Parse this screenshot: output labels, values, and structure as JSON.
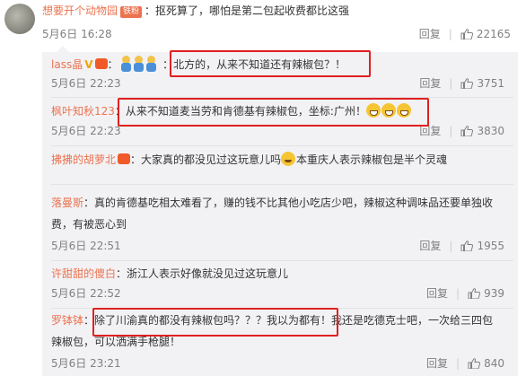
{
  "main_comment": {
    "username": "想要开个动物园",
    "badge": "铁粉",
    "text": "：抠死算了，哪怕是第二包起收费都比这强",
    "time": "5月6日 16:28",
    "reply_label": "回复",
    "likes": "22165"
  },
  "replies": [
    {
      "username": "lass晶",
      "icons": [
        "v-icon",
        "crown-icon"
      ],
      "text": "：北方的，从来不知道还有辣椒包？！",
      "time": "5月6日 22:23",
      "likes": "3751"
    },
    {
      "username": "枫叶知秋123",
      "text": "：从来不知道麦当劳和肯德基有辣椒包，坐标:广州！",
      "time": "5月6日 22:23",
      "likes": "3830"
    },
    {
      "username": "拂拂的胡萝北",
      "text1": "：大家真的都没见过这玩意儿吗",
      "text2": "本重庆人表示辣椒包是半个灵魂",
      "time": "",
      "likes": ""
    },
    {
      "username": "落曼斯",
      "line1": "：真的肯德基吃相太难看了，赚的钱不比其他小吃店少吧，辣椒这种调味品还要单独收",
      "line2": "费，有被恶心到",
      "time": "5月6日 22:51",
      "likes": "1955"
    },
    {
      "username": "许甜甜的傻白",
      "text": "：浙江人表示好像就没见过这玩意儿",
      "time": "5月6日 22:52",
      "likes": "939"
    },
    {
      "username": "罗钵钵",
      "line1": "：除了川渝真的都没有辣椒包吗？？？我以为都有！我还是吃德克士吧，一次给三四包",
      "line2": "辣椒包，可以洒满手枪腿！",
      "time": "5月6日 23:21",
      "likes": "840"
    }
  ],
  "reply_label": "回复",
  "colors": {
    "username": "#eb7350",
    "highlight_box": "#e02020",
    "panel_bg": "#f2f2f5"
  }
}
